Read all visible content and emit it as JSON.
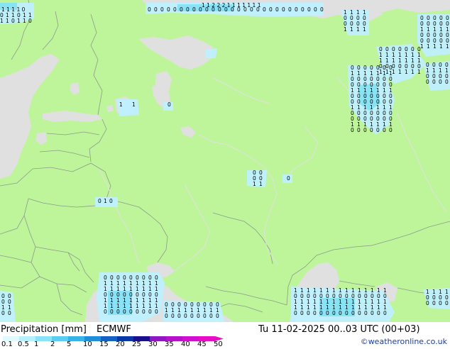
{
  "footer": {
    "product": "Precipitation [mm]",
    "model": "ECMWF",
    "valid": "Tu 11-02-2025 00..03 UTC (00+03)",
    "credit": "©weatheronline.co.uk"
  },
  "legend": {
    "ticks": [
      "0.1",
      "0.5",
      "1",
      "2",
      "5",
      "10",
      "15",
      "20",
      "25",
      "30",
      "35",
      "40",
      "45",
      "50"
    ],
    "colors": [
      "#dffaff",
      "#b4f0ff",
      "#86e3f8",
      "#5ccdf2",
      "#38b3ea",
      "#1f8fd8",
      "#1461c2",
      "#0a37a6",
      "#1a108c",
      "#8f17c2",
      "#b511c8",
      "#d10fcf",
      "#e60ec4"
    ]
  },
  "colors": {
    "land": "#bff59a",
    "sea": "#e0e0e0",
    "precip_light": "#bff0ff",
    "precip_mid": "#86e3f8",
    "border": "#8c9a8c"
  },
  "map_labels": [
    {
      "id": "north-edge",
      "text": "1 1 2 2 2 1 1 1 1 1 1 1"
    },
    {
      "id": "northwest-edge",
      "text": "1 1 1 1 0"
    }
  ]
}
